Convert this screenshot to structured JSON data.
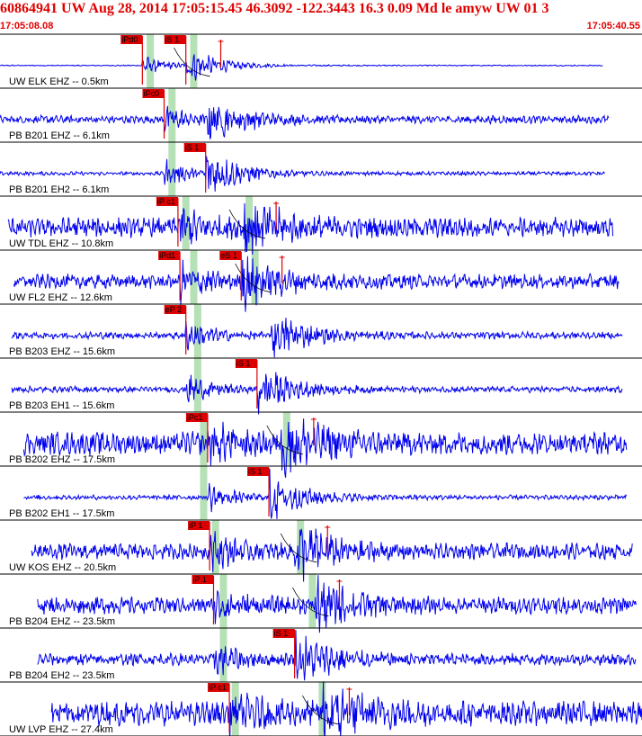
{
  "header": {
    "title": "60864941 UW Aug 28, 2014 17:05:15.45   46.3092 -122.3443 16.3 0.09 Md le amyw UW 01   3",
    "time_start": "17:05:08.08",
    "time_end": "17:05:40.55"
  },
  "colors": {
    "trace": "#0000ee",
    "pick": "#dd0000",
    "window": "#b6e0b6",
    "header": "#e00000"
  },
  "chart_data": {
    "type": "seismogram",
    "x_unit": "seconds from 17:05:08.08",
    "xlim": [
      0,
      32.47
    ],
    "traces": [
      {
        "label": "UW ELK EHZ -- 0.5km",
        "amp": 0.5,
        "noise": 0.05,
        "start": 0.0,
        "end": 30.5,
        "p": 7.2,
        "s": 9.4,
        "picks": [
          {
            "label": "iPd0",
            "t": 7.2
          },
          {
            "label": "iS 1",
            "t": 9.4
          }
        ],
        "p_win": 7.6,
        "s_win": 9.8
      },
      {
        "label": "PB B201 EHZ -- 6.1km",
        "amp": 0.7,
        "noise": 0.25,
        "start": 0.0,
        "end": 30.8,
        "p": 8.3,
        "s": 10.5,
        "picks": [
          {
            "label": "iPc0",
            "t": 8.3
          }
        ],
        "p_win": 8.7,
        "s_win": null
      },
      {
        "label": "PB B201 EH2 -- 6.1km",
        "amp": 0.7,
        "noise": 0.12,
        "start": 0.0,
        "end": 30.6,
        "p": 8.3,
        "s": 10.4,
        "picks": [
          {
            "label": "iS 1",
            "t": 10.4
          }
        ],
        "p_win": 8.7,
        "s_win": null
      },
      {
        "label": "UW TDL EHZ -- 10.8km",
        "amp": 0.8,
        "noise": 0.55,
        "start": 0.4,
        "end": 31.0,
        "p": 9.0,
        "s": 12.3,
        "picks": [
          {
            "label": "iP c1",
            "t": 9.0
          }
        ],
        "p_win": 9.4,
        "s_win": 12.6
      },
      {
        "label": "UW FL2 EHZ -- 12.6km",
        "amp": 0.8,
        "noise": 0.4,
        "start": 0.7,
        "end": 31.3,
        "p": 9.1,
        "s": 12.2,
        "picks": [
          {
            "label": "iPd1",
            "t": 9.1
          },
          {
            "label": "eS 1",
            "t": 12.2
          }
        ],
        "p_win": 9.8,
        "s_win": 12.9
      },
      {
        "label": "PB B203 EHZ -- 15.6km",
        "amp": 0.7,
        "noise": 0.22,
        "start": 0.6,
        "end": 31.5,
        "p": 9.4,
        "s": 13.7,
        "picks": [
          {
            "label": "eP 2",
            "t": 9.4
          }
        ],
        "p_win": 10.0,
        "s_win": null
      },
      {
        "label": "PB B203 EH1 -- 15.6km",
        "amp": 0.7,
        "noise": 0.2,
        "start": 0.6,
        "end": 31.5,
        "p": 9.4,
        "s": 13.0,
        "picks": [
          {
            "label": "iS 1",
            "t": 13.0
          }
        ],
        "p_win": 10.0,
        "s_win": null
      },
      {
        "label": "PB B202 EHZ -- 17.5km",
        "amp": 0.85,
        "noise": 0.6,
        "start": 1.2,
        "end": 31.7,
        "p": 10.5,
        "s": 14.2,
        "picks": [
          {
            "label": "iPc1",
            "t": 10.5
          }
        ],
        "p_win": 10.3,
        "s_win": 14.5
      },
      {
        "label": "PB B202 EH1 -- 17.5km",
        "amp": 0.7,
        "noise": 0.15,
        "start": 1.2,
        "end": 31.7,
        "p": 10.5,
        "s": 13.6,
        "picks": [
          {
            "label": "iS 1",
            "t": 13.6
          }
        ],
        "p_win": 10.3,
        "s_win": null
      },
      {
        "label": "UW KOS EHZ -- 20.5km",
        "amp": 0.8,
        "noise": 0.45,
        "start": 1.6,
        "end": 32.0,
        "p": 10.6,
        "s": 14.9,
        "picks": [
          {
            "label": "iP 1",
            "t": 10.6
          }
        ],
        "p_win": 10.9,
        "s_win": 15.2
      },
      {
        "label": "PB B204 EHZ -- 23.5km",
        "amp": 0.75,
        "noise": 0.5,
        "start": 1.9,
        "end": 32.2,
        "p": 10.8,
        "s": 15.9,
        "picks": [
          {
            "label": "iP 1",
            "t": 10.8
          }
        ],
        "p_win": 11.3,
        "s_win": 15.8
      },
      {
        "label": "PB B204 EH2 -- 23.5km",
        "amp": 0.75,
        "noise": 0.35,
        "start": 1.9,
        "end": 32.2,
        "p": 10.8,
        "s": 14.9,
        "picks": [
          {
            "label": "iS 1",
            "t": 14.9
          }
        ],
        "p_win": 11.3,
        "s_win": null
      },
      {
        "label": "UW LVP EHZ -- 27.4km",
        "amp": 0.9,
        "noise": 0.6,
        "start": 2.6,
        "end": 32.47,
        "p": 11.6,
        "s": 16.3,
        "picks": [
          {
            "label": "iP c1",
            "t": 11.6
          }
        ],
        "p_win": 11.9,
        "s_win": 16.3
      }
    ]
  }
}
